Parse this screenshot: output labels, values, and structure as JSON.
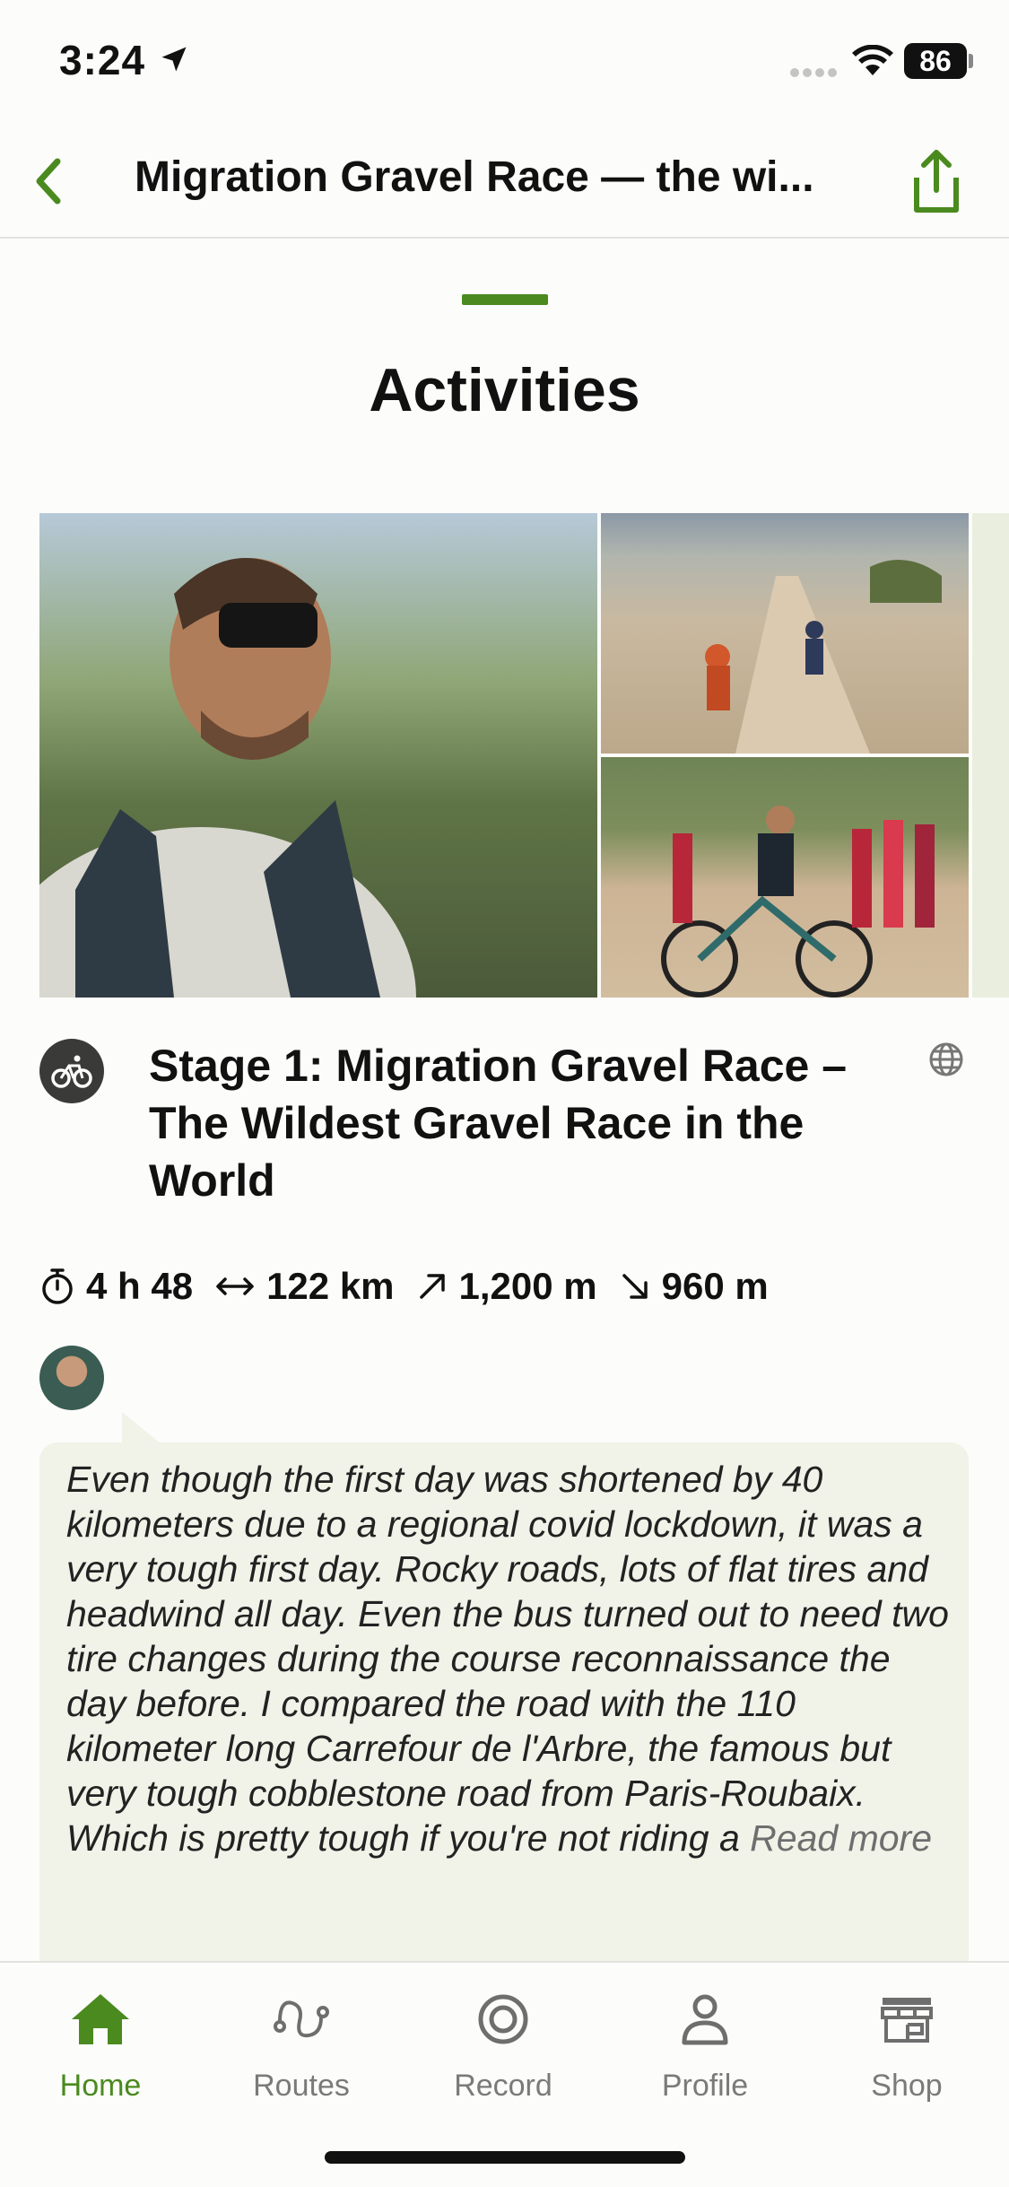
{
  "status_bar": {
    "time": "3:24",
    "battery": "86"
  },
  "nav": {
    "title": "Migration Gravel Race — the wi..."
  },
  "section": {
    "title": "Activities"
  },
  "activity": {
    "title": "Stage 1: Migration Gravel Race – The Wildest Gravel Race in the World",
    "stats": {
      "duration": "4 h 48",
      "distance": "122 km",
      "ascent": "1,200 m",
      "descent": "960 m"
    },
    "description": "Even though the first day was shortened by 40 kilometers due to a regional covid lockdown, it was a very tough first day. Rocky roads, lots of flat tires and headwind all day. Even the bus turned out to need two tire changes during the course reconnaissance the day before. I compared the road with the 110 kilometer long Carrefour de l'Arbre, the famous but very tough cobblestone road from Paris-Roubaix. Which is pretty tough if you're not riding a",
    "read_more": "Read more"
  },
  "tabbar": {
    "items": [
      {
        "label": "Home",
        "icon": "home-icon"
      },
      {
        "label": "Routes",
        "icon": "routes-icon"
      },
      {
        "label": "Record",
        "icon": "record-icon"
      },
      {
        "label": "Profile",
        "icon": "profile-icon"
      },
      {
        "label": "Shop",
        "icon": "shop-icon"
      }
    ]
  },
  "colors": {
    "accent": "#4a8a1e",
    "bubble": "#f1f2e8",
    "muted": "#7a7a7a"
  }
}
